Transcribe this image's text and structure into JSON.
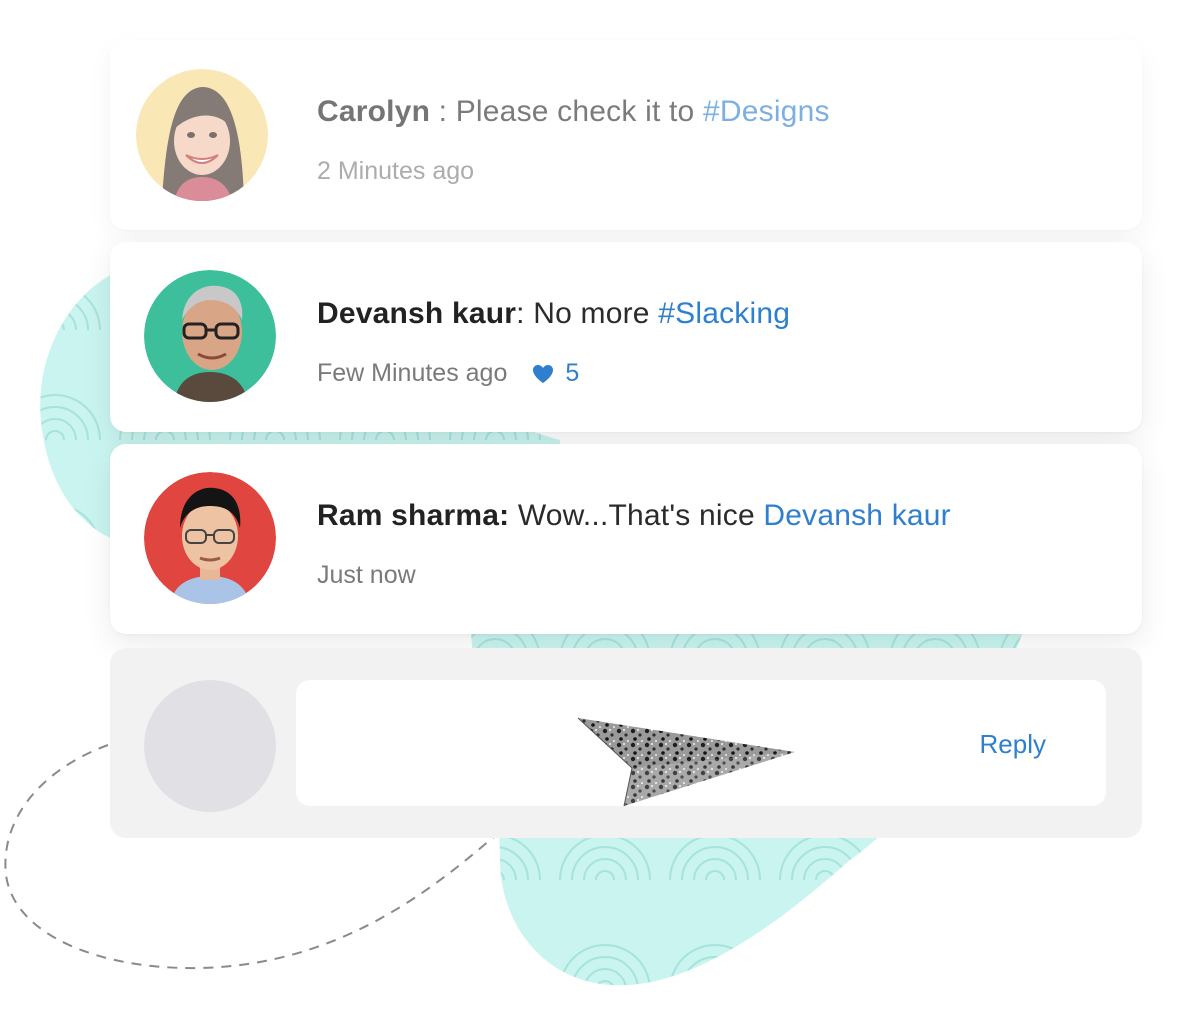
{
  "comments": [
    {
      "author": "Carolyn",
      "separator": " : ",
      "text": "Please check it to ",
      "tag": "#Designs",
      "time": "2 Minutes ago",
      "avatar_bg": "#f6d98b"
    },
    {
      "author": "Devansh kaur",
      "separator": ": ",
      "text": "No more ",
      "tag": "#Slacking",
      "time": "Few Minutes ago",
      "likes": "5",
      "avatar_bg": "#3dbf9b"
    },
    {
      "author": "Ram sharma:",
      "separator": " ",
      "text": "Wow...That's nice ",
      "tag": "Devansh kaur",
      "time": "Just now",
      "avatar_bg": "#e0453f"
    }
  ],
  "reply": {
    "button_label": "Reply"
  },
  "colors": {
    "accent": "#2f7fcf",
    "decor_blob": "#c9f4ef",
    "reply_bg": "#f2f2f3"
  }
}
